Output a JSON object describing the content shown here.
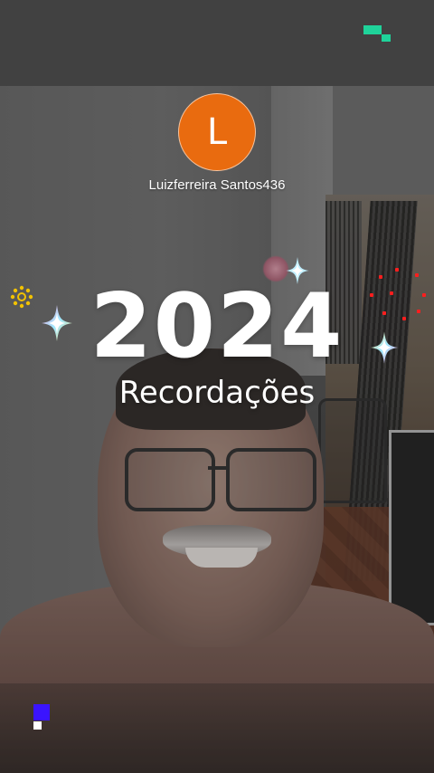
{
  "profile": {
    "avatar_initial": "L",
    "avatar_color": "#e96b0f",
    "username": "Luizferreira Santos436"
  },
  "headline": {
    "year": "2024",
    "subtitle": "Recordações"
  },
  "brand": {
    "top_mark_color": "#1fd39a",
    "bottom_mark_color": "#3a14ff"
  },
  "decorations": {
    "sparkle_icons": [
      "sparkle-icon",
      "sparkle-icon",
      "sparkle-icon"
    ],
    "sun_icon": "sun-icon",
    "dot_color": "#ff1e1e"
  }
}
